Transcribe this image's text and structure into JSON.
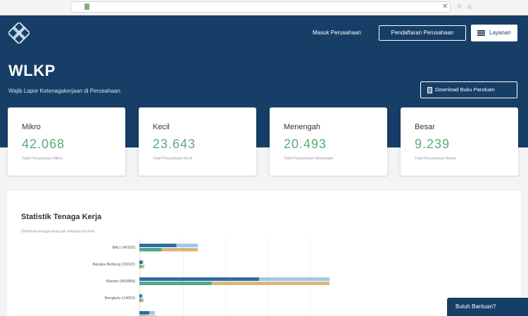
{
  "browser": {
    "url_host": "",
    "url_path": ""
  },
  "header": {
    "logo_line1": "",
    "logo_line2": "",
    "logo_line3": "",
    "nav_link": "Masuk Perusahaan",
    "nav_outline": "Pendaftaran Perusahaan",
    "nav_login": "Layanan",
    "title": "WLKP",
    "subtitle": "Wajib Lapor Ketenagakerjaan di Perusahaan",
    "download": "Download Buku Panduan"
  },
  "cards": [
    {
      "label": "Mikro",
      "value": "42.068",
      "desc": "Total Perusahaan Mikro"
    },
    {
      "label": "Kecil",
      "value": "23.643",
      "desc": "Total Perusahaan Kecil"
    },
    {
      "label": "Menengah",
      "value": "20.493",
      "desc": "Total Perusahaan Menengah"
    },
    {
      "label": "Besar",
      "value": "9.239",
      "desc": "Total Perusahaan Besar"
    }
  ],
  "stats": {
    "title": "Statistik Tenaga Kerja",
    "subtitle": "Distribusi tenaga kerja per wilayah provinsi",
    "chart_data": {
      "type": "bar",
      "orientation": "horizontal",
      "categories": [
        "BALI (46183)",
        "Bangka Belitung (15022)",
        "Banten (465884)",
        "Bengkulu (14052)",
        ""
      ],
      "series": [
        {
          "values": [
            46183,
            3500,
            150000,
            3000,
            12000
          ]
        },
        {
          "values": [
            46183,
            4000,
            150000,
            3500,
            14000
          ]
        }
      ],
      "xlim": [
        0,
        200000
      ]
    }
  },
  "help": {
    "label": "Butuh Bantuan?"
  },
  "colors": {
    "navy": "#173e66",
    "green": "#5aab76",
    "bar_blue": "#2e6da4",
    "bar_light": "#9ec9e2",
    "bar_teal": "#4fa88c",
    "bar_tan": "#d9b77e"
  }
}
